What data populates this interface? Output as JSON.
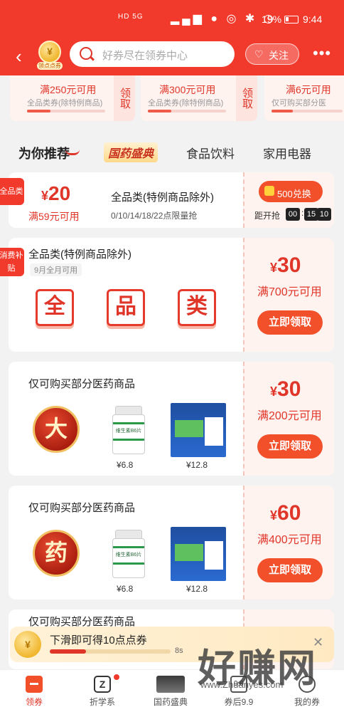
{
  "status_bar": {
    "network": "HD 5G",
    "battery": "19%",
    "time": "9:44"
  },
  "header": {
    "badge_label": "领点点券",
    "badge_coin": "¥",
    "search_placeholder": "好券尽在领券中心",
    "follow_label": "关注",
    "more_label": "•••"
  },
  "top_coupons": [
    {
      "main": "满250元可用",
      "sub": "全品类券(除特例商品)",
      "action": "领取",
      "progress": 0.3
    },
    {
      "main": "满300元可用",
      "sub": "全品类券(除特例商品)",
      "action": "领取",
      "progress": 0.3
    },
    {
      "main": "满6元可用",
      "sub": "仅可购买部分医",
      "action": "",
      "progress": 0.3
    }
  ],
  "tabs": [
    {
      "label": "为你推荐"
    },
    {
      "label": "国药盛典"
    },
    {
      "label": "食品饮料"
    },
    {
      "label": "家用电器"
    }
  ],
  "coupon1": {
    "tag": "全品类",
    "yen": "¥",
    "amount": "20",
    "condition": "满59元可用",
    "title": "全品类(特例商品除外)",
    "subtitle": "0/10/14/18/22点限量抢",
    "redeem_label": "500兑换",
    "countdown_label": "距开抢",
    "countdown": [
      "00",
      "15",
      "10"
    ]
  },
  "coupon2": {
    "tag": "消费补贴",
    "title": "全品类(特例商品除外)",
    "subtitle": "9月全月可用",
    "chars": [
      "全",
      "品",
      "类"
    ],
    "yen": "¥",
    "amount": "30",
    "condition": "满700元可用",
    "action": "立即领取"
  },
  "coupon3": {
    "title": "仅可购买部分医药商品",
    "medal": "大",
    "bottle_text": "维生素B6片",
    "prices": [
      "¥6.8",
      "¥12.8"
    ],
    "yen": "¥",
    "amount": "30",
    "condition": "满200元可用",
    "action": "立即领取"
  },
  "coupon4": {
    "title": "仅可购买部分医药商品",
    "medal": "药",
    "bottle_text": "维生素B6片",
    "prices": [
      "¥6.8",
      "¥12.8"
    ],
    "yen": "¥",
    "amount": "60",
    "condition": "满400元可用",
    "action": "立即领取"
  },
  "coupon5": {
    "title": "仅可购买部分医药商品"
  },
  "notice": {
    "text": "下滑即可得10点点券",
    "seconds": "8s",
    "progress": 0.3,
    "coin": "¥"
  },
  "bottom_nav": [
    {
      "label": "领券",
      "icon": "ticket-icon"
    },
    {
      "label": "折学系",
      "icon": "z-icon"
    },
    {
      "label": "国药盛典",
      "icon": "event-image-icon"
    },
    {
      "label": "券后9.9",
      "icon": "price-99-icon"
    },
    {
      "label": "我的券",
      "icon": "my-coupons-icon"
    }
  ],
  "watermark": {
    "text": "好赚网",
    "url": "www.Zhuanyes.com"
  },
  "colors": {
    "brand_red": "#f23a2c",
    "coupon_red": "#e0362a",
    "button_orange": "#f2502b"
  }
}
